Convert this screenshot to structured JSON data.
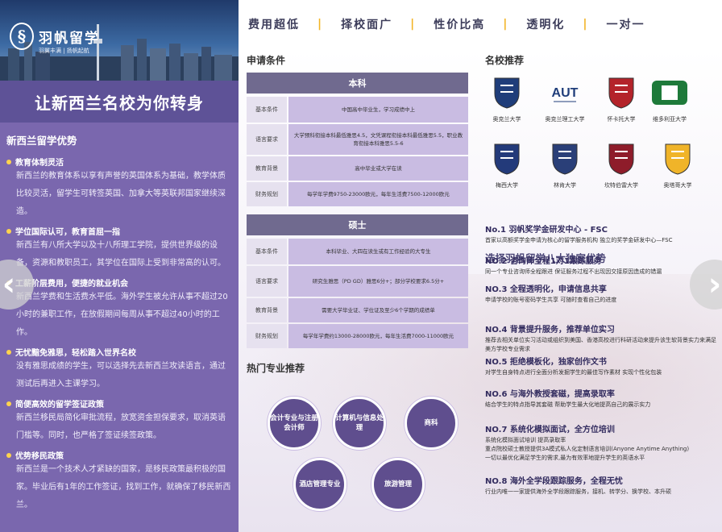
{
  "brand": {
    "logo_text": "羽帆留学",
    "logo_sub": "羽翼丰满 | 扬帆起航",
    "slogan": "让新西兰名校为你转身"
  },
  "strip": [
    "费用超低",
    "择校面广",
    "性价比高",
    "透明化",
    "一对一"
  ],
  "left": {
    "title": "新西兰留学优势",
    "advantages": [
      {
        "title": "教育体制灵活",
        "body": "新西兰的教育体系以享有声誉的英国体系为基础，教学体质比较灵活，留学生可转签英国、加拿大等英联邦国家继续深造。"
      },
      {
        "title": "学位国际认可，教育首屈一指",
        "body": "新西兰有八所大学以及十八所理工学院，提供世界级的设备，资源和教职员工，其学位在国际上受到非常高的认可。"
      },
      {
        "title": "工薪阶层费用，便捷的就业机会",
        "body": "新西兰学费和生活费水平低。海外学生被允许从事不超过20小时的兼职工作，在放假期间每周从事不超过40小时的工作。"
      },
      {
        "title": "无忧黯免雅思，轻松踏入世界名校",
        "body": "没有雅思成绩的学生，可以选择先去新西兰攻读语言，通过测试后再进入主课学习。"
      },
      {
        "title": "简便高效的留学签证政策",
        "body": "新西兰移民局简化审批流程，放宽资金担保要求，取消英语门槛等。同时，也严格了签证续签政策。"
      },
      {
        "title": "优势移民政策",
        "body": "新西兰是一个技术人才紧缺的国家，是移民政策最积极的国家。毕业后有1年的工作签证，找到工作，就确保了移民新西兰。"
      }
    ]
  },
  "apply": {
    "title": "申请条件",
    "bachelor": {
      "head": "本科",
      "rows": [
        {
          "k": "基本条件",
          "v": "中国高中毕业生，学习成绩中上"
        },
        {
          "k": "语言要求",
          "v": "大学预科衔接本科最低雅思4.5，文凭课程衔接本科最低雅思5.5，职业教育衔接本科雅思5.5-6"
        },
        {
          "k": "教育背景",
          "v": "高中毕业或大学在读"
        },
        {
          "k": "财务规划",
          "v": "每学年学费9750-23000欧元，每年生活费7500-12000欧元"
        }
      ]
    },
    "master": {
      "head": "硕士",
      "rows": [
        {
          "k": "基本条件",
          "v": "本科毕业、大四在读生或有工作经验的大专生"
        },
        {
          "k": "语言要求",
          "v": "研究生雅思（PD GD）雅思6分+；部分学校要求6.5分+"
        },
        {
          "k": "教育背景",
          "v": "需要大学毕业证、学位证及至少6个学期的成绩单"
        },
        {
          "k": "财务规划",
          "v": "每学年学费约13000-28000欧元，每年生活费7000-11000欧元"
        }
      ]
    }
  },
  "majors": {
    "title": "热门专业推荐",
    "items": [
      "会计专业与注册会计师",
      "计算机与信息处理",
      "商科",
      "酒店管理专业",
      "旅游管理"
    ]
  },
  "schools": {
    "title": "名校推荐",
    "items": [
      {
        "name": "奥克兰大学",
        "color": "#1f3d7a"
      },
      {
        "name": "奥克兰理工大学",
        "color": "#1f3d7a"
      },
      {
        "name": "怀卡托大学",
        "color": "#b4232a"
      },
      {
        "name": "维多利亚大学",
        "color": "#1e7a3a"
      },
      {
        "name": "梅西大学",
        "color": "#233a7a"
      },
      {
        "name": "林肯大学",
        "color": "#2a3f78"
      },
      {
        "name": "坎特伯雷大学",
        "color": "#8e1c2a"
      },
      {
        "name": "奥塔哥大学",
        "color": "#f0b429"
      }
    ]
  },
  "exclusive": {
    "title": "选择羽帆留学八大独家优势",
    "items": [
      {
        "h": "No.1 羽帆奖学金研发中心 - FSC",
        "b": "首家以高额奖学金申请为核心的留学服务机构 独立的奖学金研发中心—FSC"
      },
      {
        "h": "NO.2 咨询师全程1对1跟踪服务",
        "b": "同一个专业咨询师全程跟进 保证服务过程不出现因交接原因造成的错漏"
      },
      {
        "h": "NO.3 全程透明化，申请信息共享",
        "b": "申请学校的账号密码学生共享 可随时查看自己的进度"
      },
      {
        "h": "NO.4 背景提升服务，推荐单位实习",
        "b": "推荐去相关单位实习活动或组织到美国、香港高校进行科研活动来提升该生软背景实力来满足美方学校专业需求"
      },
      {
        "h": "NO.5 拒绝模板化，独家创作文书",
        "b": "对学生自身特点进行全面分析发掘学生的最佳写作素材 实现个性化包装"
      },
      {
        "h": "NO.6 与海外教授套磁，提高录取率",
        "b": "结合学生的特点指导其套磁 帮助学生最大化地提高自己的展示实力"
      },
      {
        "h": "NO.7 系统化模拟面试，全方位培训",
        "b": "系统化模拟面试培训 提高录取率\n重点院校硕士教授提供3A模式私人化定制语言培训(Anyone Anytime Anything)\n一切以最优化满足学生的需求,最为有效率地提升学生的英语水平"
      },
      {
        "h": "NO.8 海外全学段跟踪服务，全程无忧",
        "b": "行业内唯一一家提供海外全学段跟踪服务，接机、转学分、换学校、本升硕"
      }
    ]
  }
}
